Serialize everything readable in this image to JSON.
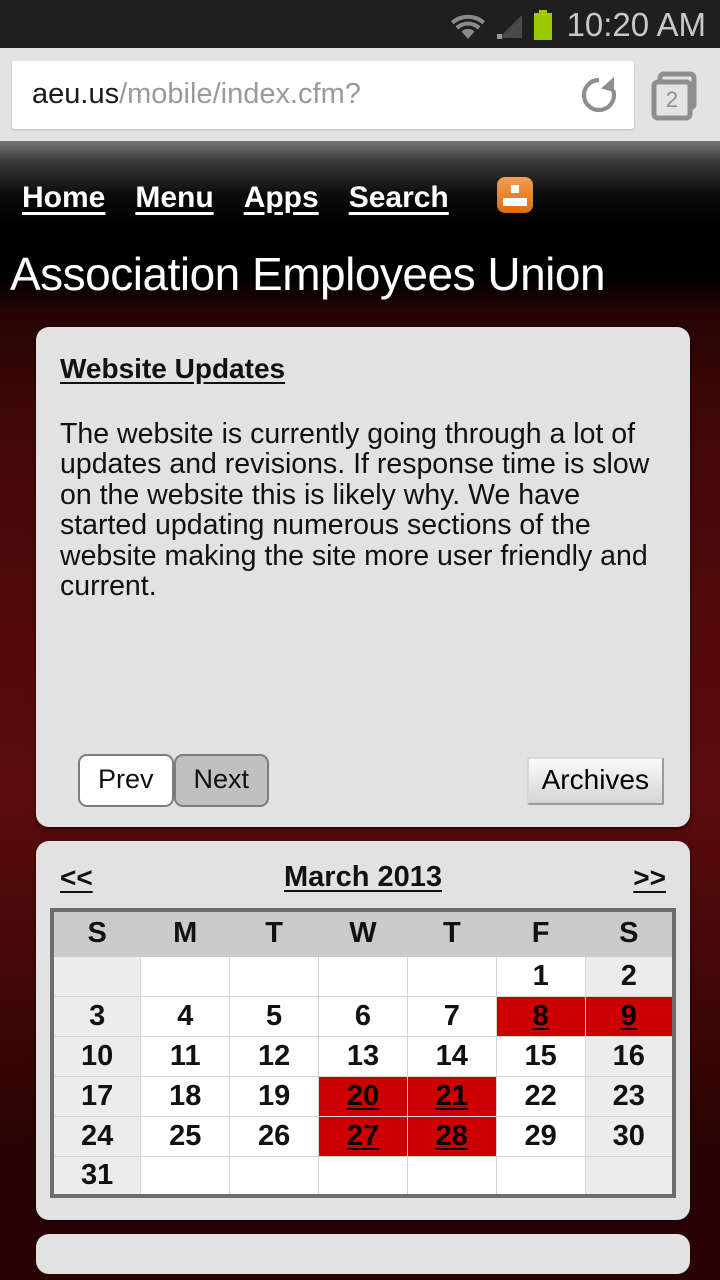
{
  "status_bar": {
    "time": "10:20 AM",
    "icons": [
      "wifi-icon",
      "signal-icon",
      "battery-icon"
    ]
  },
  "browser": {
    "url_domain": "aeu.us",
    "url_path": "/mobile/index.cfm?",
    "reload_label": "reload-icon",
    "tab_count": "2"
  },
  "nav": {
    "links": [
      {
        "label": "Home"
      },
      {
        "label": "Menu"
      },
      {
        "label": "Apps"
      },
      {
        "label": "Search"
      }
    ],
    "sitemap_icon": "sitemap-icon"
  },
  "site": {
    "title": "Association Employees Union"
  },
  "updates_card": {
    "heading": "Website Updates",
    "body": "The website is currently going through a lot of updates and revisions. If response time is slow on the website this is likely why. We have started updating numerous sections of the website making the site more user friendly and current.",
    "prev_label": "Prev",
    "next_label": "Next",
    "archives_label": "Archives"
  },
  "calendar": {
    "prev_label": "<<",
    "next_label": ">>",
    "title": "March 2013",
    "day_headers": [
      "S",
      "M",
      "T",
      "W",
      "T",
      "F",
      "S"
    ],
    "weeks": [
      [
        {
          "day": ""
        },
        {
          "day": ""
        },
        {
          "day": ""
        },
        {
          "day": ""
        },
        {
          "day": ""
        },
        {
          "day": "1"
        },
        {
          "day": "2"
        }
      ],
      [
        {
          "day": "3"
        },
        {
          "day": "4"
        },
        {
          "day": "5"
        },
        {
          "day": "6"
        },
        {
          "day": "7"
        },
        {
          "day": "8",
          "event": true
        },
        {
          "day": "9",
          "event": true
        }
      ],
      [
        {
          "day": "10"
        },
        {
          "day": "11"
        },
        {
          "day": "12"
        },
        {
          "day": "13"
        },
        {
          "day": "14"
        },
        {
          "day": "15"
        },
        {
          "day": "16"
        }
      ],
      [
        {
          "day": "17"
        },
        {
          "day": "18"
        },
        {
          "day": "19"
        },
        {
          "day": "20",
          "event": true
        },
        {
          "day": "21",
          "event": true
        },
        {
          "day": "22"
        },
        {
          "day": "23"
        }
      ],
      [
        {
          "day": "24"
        },
        {
          "day": "25"
        },
        {
          "day": "26"
        },
        {
          "day": "27",
          "event": true
        },
        {
          "day": "28",
          "event": true
        },
        {
          "day": "29"
        },
        {
          "day": "30"
        }
      ],
      [
        {
          "day": "31"
        },
        {
          "day": ""
        },
        {
          "day": ""
        },
        {
          "day": ""
        },
        {
          "day": ""
        },
        {
          "day": ""
        },
        {
          "day": ""
        }
      ]
    ]
  },
  "colors": {
    "page_background": "#4e0909",
    "card_background": "#e2e2e2",
    "event_red": "#cc0000",
    "accent_orange": "#e8812b",
    "battery_green": "#9ccc00",
    "status_bar": "#1f1f1f"
  }
}
